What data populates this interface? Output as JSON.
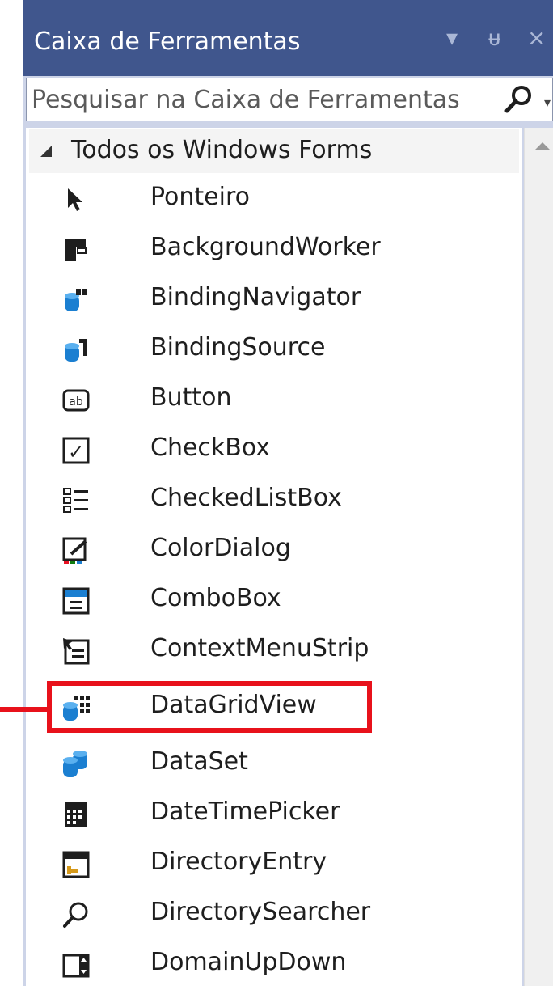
{
  "panel": {
    "title": "Caixa de Ferramentas",
    "controls": {
      "dropdown": "▾",
      "pin": "ᵾ",
      "close": "×"
    }
  },
  "search": {
    "placeholder": "Pesquisar na Caixa de Ferramentas"
  },
  "group": {
    "label": "Todos os Windows Forms"
  },
  "items": [
    {
      "label": "Ponteiro",
      "icon": "pointer-icon"
    },
    {
      "label": "BackgroundWorker",
      "icon": "background-worker-icon"
    },
    {
      "label": "BindingNavigator",
      "icon": "binding-navigator-icon"
    },
    {
      "label": "BindingSource",
      "icon": "binding-source-icon"
    },
    {
      "label": "Button",
      "icon": "button-icon",
      "glyph": "ab"
    },
    {
      "label": "CheckBox",
      "icon": "checkbox-icon",
      "glyph": "✓"
    },
    {
      "label": "CheckedListBox",
      "icon": "checked-list-box-icon"
    },
    {
      "label": "ColorDialog",
      "icon": "color-dialog-icon"
    },
    {
      "label": "ComboBox",
      "icon": "combo-box-icon"
    },
    {
      "label": "ContextMenuStrip",
      "icon": "context-menu-strip-icon"
    },
    {
      "label": "DataGridView",
      "icon": "data-grid-view-icon",
      "highlighted": true
    },
    {
      "label": "DataSet",
      "icon": "data-set-icon"
    },
    {
      "label": "DateTimePicker",
      "icon": "date-time-picker-icon"
    },
    {
      "label": "DirectoryEntry",
      "icon": "directory-entry-icon"
    },
    {
      "label": "DirectorySearcher",
      "icon": "directory-searcher-icon"
    },
    {
      "label": "DomainUpDown",
      "icon": "domain-up-down-icon"
    }
  ],
  "colors": {
    "titlebar": "#40568d",
    "highlight": "#e8111b",
    "data_icon_blue": "#1b7fd1"
  }
}
